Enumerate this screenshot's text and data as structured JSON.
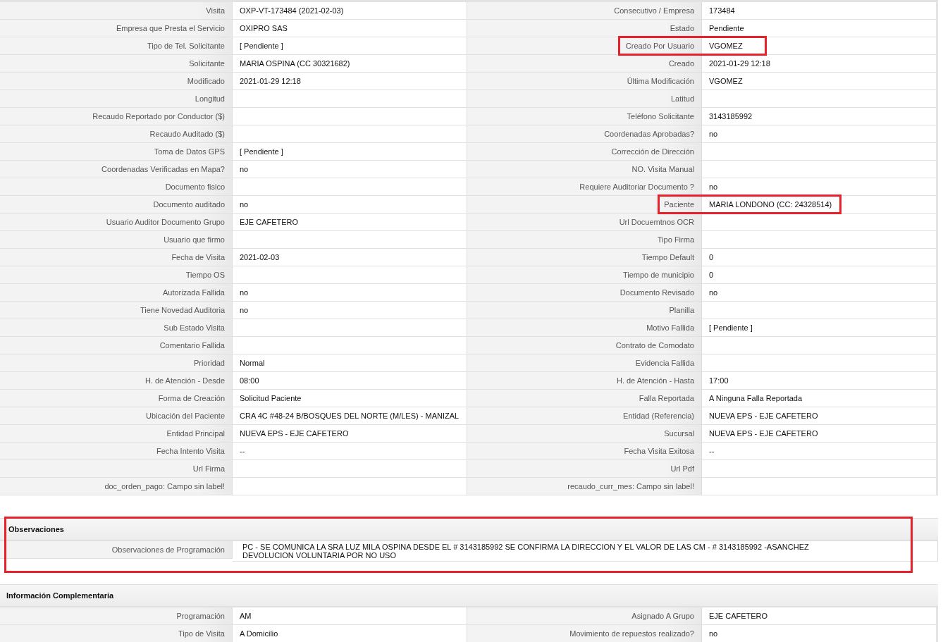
{
  "main_fields": [
    {
      "left": {
        "label": "Visita",
        "value": "OXP-VT-173484 (2021-02-03)"
      },
      "right": {
        "label": "Consecutivo / Empresa",
        "value": "173484"
      }
    },
    {
      "left": {
        "label": "Empresa que Presta el Servicio",
        "value": "OXIPRO SAS"
      },
      "right": {
        "label": "Estado",
        "value": "Pendiente"
      }
    },
    {
      "left": {
        "label": "Tipo de Tel. Solicitante",
        "value": "[ Pendiente ]"
      },
      "right": {
        "label": "Creado Por Usuario",
        "value": "VGOMEZ",
        "highlighted": true
      }
    },
    {
      "left": {
        "label": "Solicitante",
        "value": "MARIA OSPINA (CC 30321682)"
      },
      "right": {
        "label": "Creado",
        "value": "2021-01-29 12:18"
      }
    },
    {
      "left": {
        "label": "Modificado",
        "value": "2021-01-29 12:18"
      },
      "right": {
        "label": "Última Modificación",
        "value": "VGOMEZ"
      }
    },
    {
      "left": {
        "label": "Longitud"
      },
      "right": {
        "label": "Latitud"
      }
    },
    {
      "left": {
        "label": "Recaudo Reportado por Conductor ($)"
      },
      "right": {
        "label": "Teléfono Solicitante",
        "value": "3143185992"
      }
    },
    {
      "left": {
        "label": "Recaudo Auditado ($)"
      },
      "right": {
        "label": "Coordenadas Aprobadas?",
        "value": "no"
      }
    },
    {
      "left": {
        "label": "Toma de Datos GPS",
        "value": "[ Pendiente ]"
      },
      "right": {
        "label": "Corrección de Dirección"
      }
    },
    {
      "left": {
        "label": "Coordenadas Verificadas en Mapa?",
        "value": "no"
      },
      "right": {
        "label": "NO. Visita Manual"
      }
    },
    {
      "left": {
        "label": "Documento fisico"
      },
      "right": {
        "label": "Requiere Auditoriar Documento ?",
        "value": "no"
      }
    },
    {
      "left": {
        "label": "Documento auditado",
        "value": "no"
      },
      "right": {
        "label": "Paciente",
        "value": "MARIA LONDONO (CC: 24328514)",
        "highlighted": true
      }
    },
    {
      "left": {
        "label": "Usuario Auditor Documento Grupo",
        "value": "EJE CAFETERO"
      },
      "right": {
        "label": "Url Docuemtnos OCR"
      }
    },
    {
      "left": {
        "label": "Usuario que firmo"
      },
      "right": {
        "label": "Tipo Firma"
      }
    },
    {
      "left": {
        "label": "Fecha de Visita",
        "value": "2021-02-03"
      },
      "right": {
        "label": "Tiempo Default",
        "value": "0"
      }
    },
    {
      "left": {
        "label": "Tiempo OS"
      },
      "right": {
        "label": "Tiempo de municipio",
        "value": "0"
      }
    },
    {
      "left": {
        "label": "Autorizada Fallida",
        "value": "no"
      },
      "right": {
        "label": "Documento Revisado",
        "value": "no"
      }
    },
    {
      "left": {
        "label": "Tiene Novedad Auditoria",
        "value": "no"
      },
      "right": {
        "label": "Planilla"
      }
    },
    {
      "left": {
        "label": "Sub Estado Visita"
      },
      "right": {
        "label": "Motivo Fallida",
        "value": "[ Pendiente ]"
      }
    },
    {
      "left": {
        "label": "Comentario Fallida"
      },
      "right": {
        "label": "Contrato de Comodato"
      }
    },
    {
      "left": {
        "label": "Prioridad",
        "value": "Normal"
      },
      "right": {
        "label": "Evidencia Fallida"
      }
    },
    {
      "left": {
        "label": "H. de Atención - Desde",
        "value": "08:00"
      },
      "right": {
        "label": "H. de Atención - Hasta",
        "value": "17:00"
      }
    },
    {
      "left": {
        "label": "Forma de Creación",
        "value": "Solicitud Paciente"
      },
      "right": {
        "label": "Falla Reportada",
        "value": "A Ninguna Falla Reportada"
      }
    },
    {
      "left": {
        "label": "Ubicación del Paciente",
        "value": "CRA 4C #48-24 B/BOSQUES DEL NORTE (M/LES) - MANIZAL"
      },
      "right": {
        "label": "Entidad (Referencia)",
        "value": "NUEVA EPS - EJE CAFETERO"
      }
    },
    {
      "left": {
        "label": "Entidad Principal",
        "value": "NUEVA EPS - EJE CAFETERO"
      },
      "right": {
        "label": "Sucursal",
        "value": "NUEVA EPS - EJE CAFETERO"
      }
    },
    {
      "left": {
        "label": "Fecha Intento Visita",
        "value": "--"
      },
      "right": {
        "label": "Fecha Visita Exitosa",
        "value": "--"
      }
    },
    {
      "left": {
        "label": "Url Firma"
      },
      "right": {
        "label": "Url Pdf"
      }
    },
    {
      "left": {
        "label": "doc_orden_pago: Campo sin label!"
      },
      "right": {
        "label": "recaudo_curr_mes: Campo sin label!"
      }
    }
  ],
  "observaciones": {
    "title": "Observaciones",
    "highlighted": true,
    "label": "Observaciones de Programación",
    "lines": [
      "PC - SE COMUNICA LA SRA LUZ MILA OSPINA DESDE EL # 3143185992 SE CONFIRMA LA DIRECCION Y EL VALOR DE LAS CM - # 3143185992 -ASANCHEZ",
      "DEVOLUCION VOLUNTARIA POR NO USO"
    ]
  },
  "informacion_complementaria": {
    "title": "Información Complementaria",
    "fields": [
      {
        "left": {
          "label": "Programación",
          "value": "AM"
        },
        "right": {
          "label": "Asignado A Grupo",
          "value": "EJE CAFETERO"
        }
      },
      {
        "left": {
          "label": "Tipo de Visita",
          "value": "A Domicilio"
        },
        "right": {
          "label": "Movimiento de repuestos realizado?",
          "value": "no"
        }
      }
    ]
  }
}
